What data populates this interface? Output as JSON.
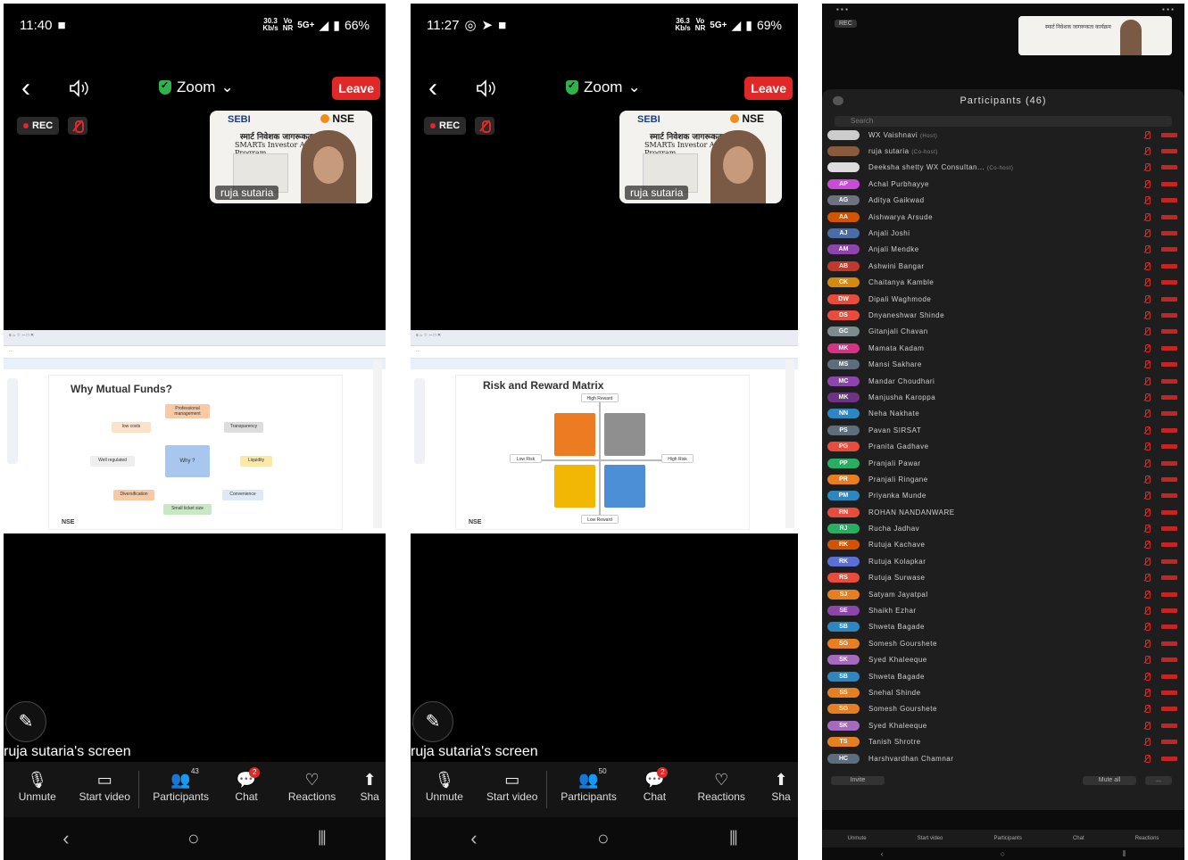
{
  "phones": [
    {
      "time": "11:40",
      "speed": "30.3",
      "battery": "66%",
      "slide_title": "Why Mutual Funds?",
      "participants_count": "43"
    },
    {
      "time": "11:27",
      "speed": "36.3",
      "battery": "69%",
      "slide_title": "Risk and Reward Matrix",
      "participants_count": "50"
    }
  ],
  "common": {
    "app_title": "Zoom",
    "leave": "Leave",
    "rec": "REC",
    "presenter_label": "ruja sutaria",
    "screen_label": "ruja sutaria's screen",
    "chat_badge": "2",
    "toolbar": {
      "unmute": "Unmute",
      "start_video": "Start video",
      "participants": "Participants",
      "chat": "Chat",
      "reactions": "Reactions",
      "share": "Sha"
    },
    "thumb": {
      "sebi": "SEBI",
      "nse": "NSE",
      "hindi": "स्मार्ट निवेशक जागरूकता कार्यक्रम",
      "smarts": "SMARTs Investor Awareness Program"
    },
    "units": {
      "kbs": "Kb/s",
      "vo": "Vo",
      "nr": "NR",
      "net": "5G+"
    },
    "nse_logo": "NSE"
  },
  "slide1": {
    "center": "Why ?",
    "boxes": [
      "Professional management",
      "Transparency",
      "low costs",
      "Liquidity",
      "Well regulated",
      "Convenience",
      "Diversification",
      "Small ticket size"
    ]
  },
  "slide2": {
    "labels": [
      "High Reward",
      "Low Reward",
      "Low Risk",
      "High Risk"
    ]
  },
  "participants_panel": {
    "title": "Participants (46)",
    "search": "Search",
    "invite": "Invite",
    "mute_all": "Mute all",
    "more": "...",
    "list": [
      {
        "initials": "",
        "name": "WX Vaishnavi",
        "role": "(Host)",
        "color": "#cccccc"
      },
      {
        "initials": "",
        "name": "ruja sutaria",
        "role": "(Co-host)",
        "color": "#8a5a3c"
      },
      {
        "initials": "",
        "name": "Deeksha shetty WX Consultan...",
        "role": "(Co-host)",
        "color": "#dddddd"
      },
      {
        "initials": "AP",
        "name": "Achal Purbhayye",
        "role": "",
        "color": "#c94bd6"
      },
      {
        "initials": "AG",
        "name": "Aditya Gaikwad",
        "role": "",
        "color": "#6b7280"
      },
      {
        "initials": "AA",
        "name": "Aishwarya Arsude",
        "role": "",
        "color": "#d35400"
      },
      {
        "initials": "AJ",
        "name": "Anjali Joshi",
        "role": "",
        "color": "#4a6da7"
      },
      {
        "initials": "AM",
        "name": "Anjali Mendke",
        "role": "",
        "color": "#8e44ad"
      },
      {
        "initials": "AB",
        "name": "Ashwini Bangar",
        "role": "",
        "color": "#c0392b"
      },
      {
        "initials": "CK",
        "name": "Chaitanya Kamble",
        "role": "",
        "color": "#d68910"
      },
      {
        "initials": "DW",
        "name": "Dipali Waghmode",
        "role": "",
        "color": "#e74c3c"
      },
      {
        "initials": "DS",
        "name": "Dnyaneshwar Shinde",
        "role": "",
        "color": "#e74c3c"
      },
      {
        "initials": "GC",
        "name": "Gitanjali Chavan",
        "role": "",
        "color": "#7f8c8d"
      },
      {
        "initials": "MK",
        "name": "Mamata Kadam",
        "role": "",
        "color": "#d63384"
      },
      {
        "initials": "MS",
        "name": "Mansi Sakhare",
        "role": "",
        "color": "#5d6d7e"
      },
      {
        "initials": "MC",
        "name": "Mandar Choudhari",
        "role": "",
        "color": "#8e44ad"
      },
      {
        "initials": "MK",
        "name": "Manjusha Karoppa",
        "role": "",
        "color": "#6c3483"
      },
      {
        "initials": "NN",
        "name": "Neha Nakhate",
        "role": "",
        "color": "#2e86c1"
      },
      {
        "initials": "PS",
        "name": "Pavan SIRSAT",
        "role": "",
        "color": "#5d6d7e"
      },
      {
        "initials": "PG",
        "name": "Pranita Gadhave",
        "role": "",
        "color": "#e74c3c"
      },
      {
        "initials": "PP",
        "name": "Pranjali Pawar",
        "role": "",
        "color": "#27ae60"
      },
      {
        "initials": "PR",
        "name": "Pranjali Ringane",
        "role": "",
        "color": "#e67e22"
      },
      {
        "initials": "PM",
        "name": "Priyanka Munde",
        "role": "",
        "color": "#2e86c1"
      },
      {
        "initials": "RN",
        "name": "ROHAN NANDANWARE",
        "role": "",
        "color": "#e74c3c"
      },
      {
        "initials": "RJ",
        "name": "Rucha Jadhav",
        "role": "",
        "color": "#27ae60"
      },
      {
        "initials": "RK",
        "name": "Rutuja Kachave",
        "role": "",
        "color": "#d35400"
      },
      {
        "initials": "RK",
        "name": "Rutuja Kolapkar",
        "role": "",
        "color": "#5b6fd6"
      },
      {
        "initials": "RS",
        "name": "Rutuja Surwase",
        "role": "",
        "color": "#e74c3c"
      },
      {
        "initials": "SJ",
        "name": "Satyam Jayatpal",
        "role": "",
        "color": "#e67e22"
      },
      {
        "initials": "SE",
        "name": "Shaikh Ezhar",
        "role": "",
        "color": "#8e44ad"
      },
      {
        "initials": "SB",
        "name": "Shweta Bagade",
        "role": "",
        "color": "#2e86c1"
      },
      {
        "initials": "SG",
        "name": "Somesh Gourshete",
        "role": "",
        "color": "#e67e22"
      },
      {
        "initials": "SK",
        "name": "Syed Khaleeque",
        "role": "",
        "color": "#a569bd"
      },
      {
        "initials": "SB",
        "name": "Shweta Bagade",
        "role": "",
        "color": "#2e86c1"
      },
      {
        "initials": "SS",
        "name": "Snehal Shinde",
        "role": "",
        "color": "#e67e22"
      },
      {
        "initials": "SG",
        "name": "Somesh Gourshete",
        "role": "",
        "color": "#e67e22"
      },
      {
        "initials": "SK",
        "name": "Syed Khaleeque",
        "role": "",
        "color": "#a569bd"
      },
      {
        "initials": "TS",
        "name": "Tanish Shrotre",
        "role": "",
        "color": "#e67e22"
      },
      {
        "initials": "HC",
        "name": "Harshvardhan Chamnar",
        "role": "",
        "color": "#5d6d7e"
      }
    ]
  }
}
